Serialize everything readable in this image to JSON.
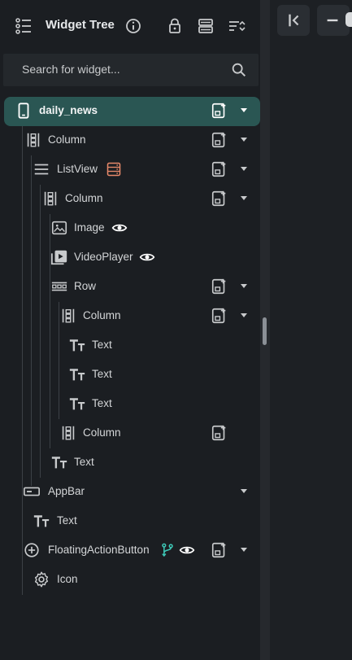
{
  "header": {
    "title": "Widget Tree",
    "icons": [
      "tree-list-icon",
      "info-icon",
      "lock-icon",
      "layers-icon",
      "sort-icon"
    ]
  },
  "search": {
    "placeholder": "Search for widget..."
  },
  "tree": {
    "root": "daily_news",
    "column_1": "Column",
    "listview": "ListView",
    "column_2": "Column",
    "image": "Image",
    "videoplayer": "VideoPlayer",
    "row": "Row",
    "column_3": "Column",
    "text_1": "Text",
    "text_2": "Text",
    "text_3": "Text",
    "column_4": "Column",
    "text_4": "Text",
    "appbar": "AppBar",
    "text_5": "Text",
    "fab": "FloatingActionButton",
    "icon": "Icon"
  },
  "colors": {
    "selected_row": "#2a5653",
    "listview_badge": "#e8896a",
    "fab_badge": "#3ec9b8"
  }
}
